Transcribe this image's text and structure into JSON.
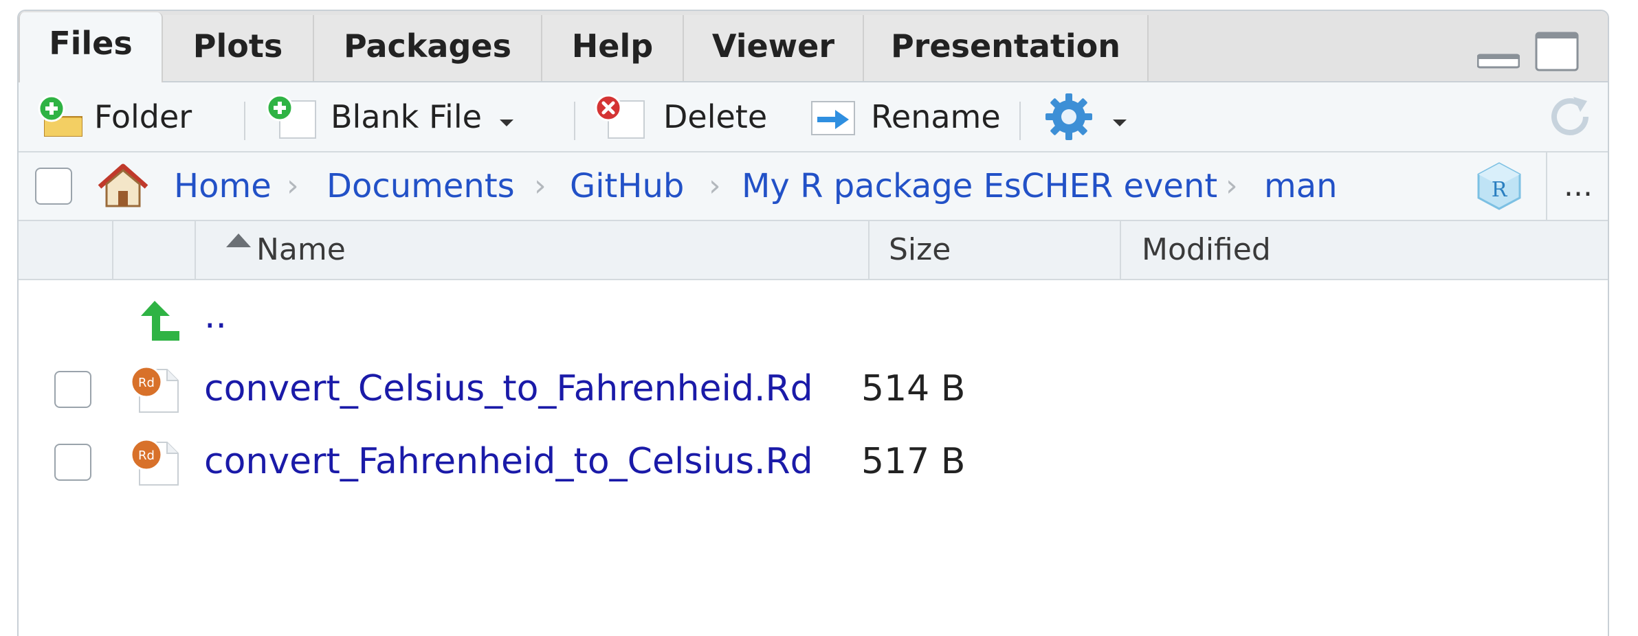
{
  "tabs": [
    {
      "label": "Files",
      "active": true
    },
    {
      "label": "Plots"
    },
    {
      "label": "Packages"
    },
    {
      "label": "Help"
    },
    {
      "label": "Viewer"
    },
    {
      "label": "Presentation"
    }
  ],
  "toolbar": {
    "new_folder_label": "Folder",
    "blank_file_label": "Blank File",
    "delete_label": "Delete",
    "rename_label": "Rename",
    "gear_icon": "gear-icon",
    "refresh_icon": "refresh-icon"
  },
  "breadcrumb": {
    "home_icon": "home-icon",
    "items": [
      "Home",
      "Documents",
      "GitHub",
      "My R package EsCHER event",
      "man"
    ],
    "more_label": "..."
  },
  "table": {
    "columns": [
      "Name",
      "Size",
      "Modified"
    ],
    "sort_column": "Name",
    "parent_link": "..",
    "rows": [
      {
        "name": "convert_Celsius_to_Fahrenheid.Rd",
        "size": "514 B",
        "modified": ""
      },
      {
        "name": "convert_Fahrenheid_to_Celsius.Rd",
        "size": "517 B",
        "modified": ""
      }
    ]
  },
  "colors": {
    "link": "#1a1aa8",
    "breadcrumb_link": "#2251c7",
    "add_green": "#2fb344",
    "delete_red": "#d43434",
    "gear_blue": "#3d8fd6"
  }
}
